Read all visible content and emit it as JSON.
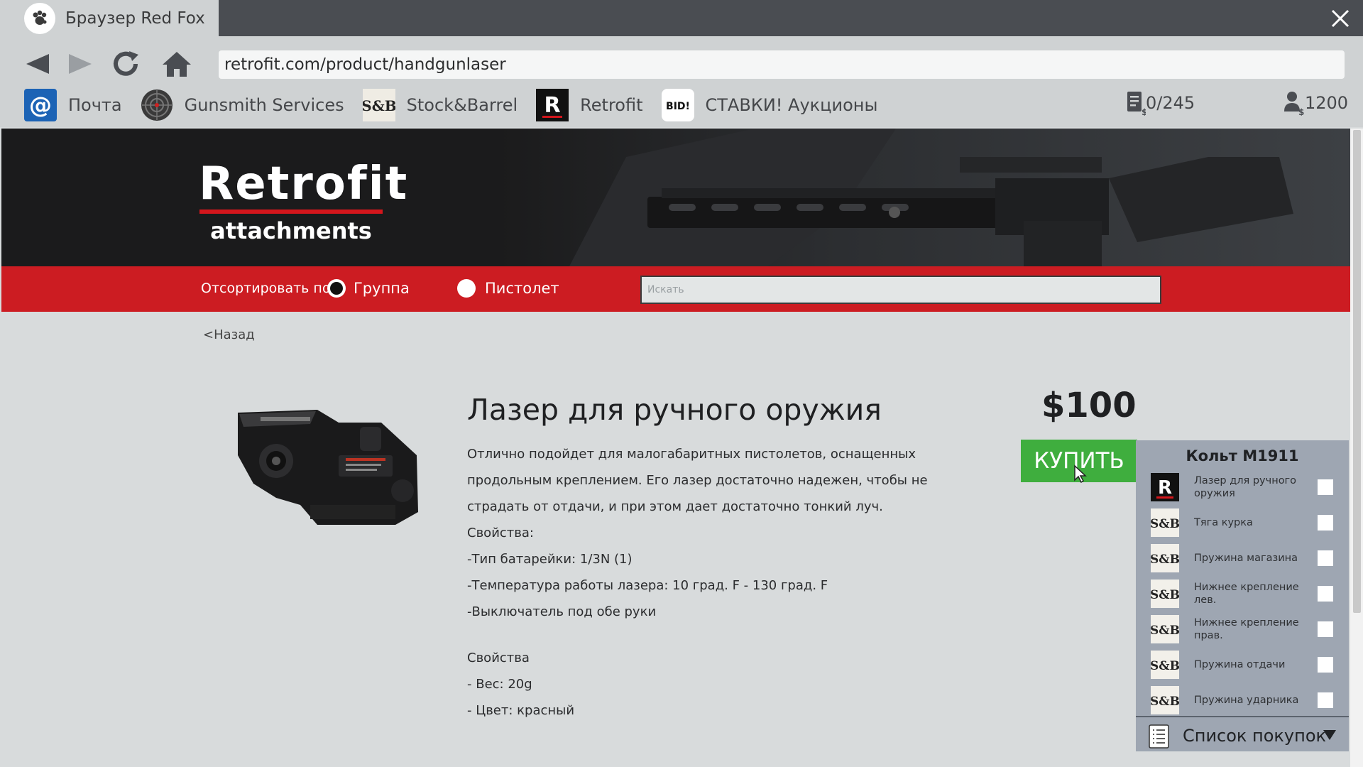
{
  "browser": {
    "title": "Браузер Red Fox",
    "url": "retrofit.com/product/handgunlaser"
  },
  "bookmarks": [
    {
      "label": "Почта",
      "icon": "mail-at-icon"
    },
    {
      "label": "Gunsmith Services",
      "icon": "target-icon"
    },
    {
      "label": "Stock&Barrel",
      "icon": "sb-logo-icon"
    },
    {
      "label": "Retrofit",
      "icon": "retrofit-r-icon"
    },
    {
      "label": "СТАВКИ! Аукционы",
      "icon": "bid-icon",
      "icon_text": "BID!"
    }
  ],
  "stats": {
    "orders": "0/245",
    "money": "1200"
  },
  "site": {
    "brand_main": "Retrofit",
    "brand_sub": "attachments",
    "sort_label": "Отсортировать по:",
    "sort_options": [
      {
        "label": "Группа",
        "checked": true
      },
      {
        "label": "Пистолет",
        "checked": false
      }
    ],
    "search_placeholder": "Искать",
    "back": "Назад"
  },
  "product": {
    "title": "Лазер для ручного оружия",
    "price": "$100",
    "buy": "КУПИТЬ",
    "description": [
      "Отлично подойдет для малогабаритных пистолетов, оснащенных продольным креплением. Его лазер достаточно надежен, чтобы не страдать от отдачи, и при этом дает достаточно тонкий луч.",
      "Свойства:",
      "-Тип батарейки: 1/3N (1)",
      "-Температура работы лазера: 10 град. F - 130 град. F",
      "-Выключатель под обе руки"
    ],
    "properties": [
      "Свойства",
      "- Вес: 20g",
      "- Цвет: красный"
    ]
  },
  "panel": {
    "title": "Кольт M1911",
    "items": [
      {
        "label": "Лазер для ручного оружия",
        "brand": "retrofit"
      },
      {
        "label": "Тяга курка",
        "brand": "sb"
      },
      {
        "label": "Пружина магазина",
        "brand": "sb"
      },
      {
        "label": "Нижнее крепление лев.",
        "brand": "sb"
      },
      {
        "label": "Нижнее крепление прав.",
        "brand": "sb"
      },
      {
        "label": "Пружина отдачи",
        "brand": "sb"
      },
      {
        "label": "Пружина ударника",
        "brand": "sb"
      }
    ],
    "footer": "Список покупок"
  },
  "colors": {
    "accent_red": "#cc1c22",
    "buy_green": "#3fae3e",
    "hero_bg": "#1b1b1c"
  }
}
